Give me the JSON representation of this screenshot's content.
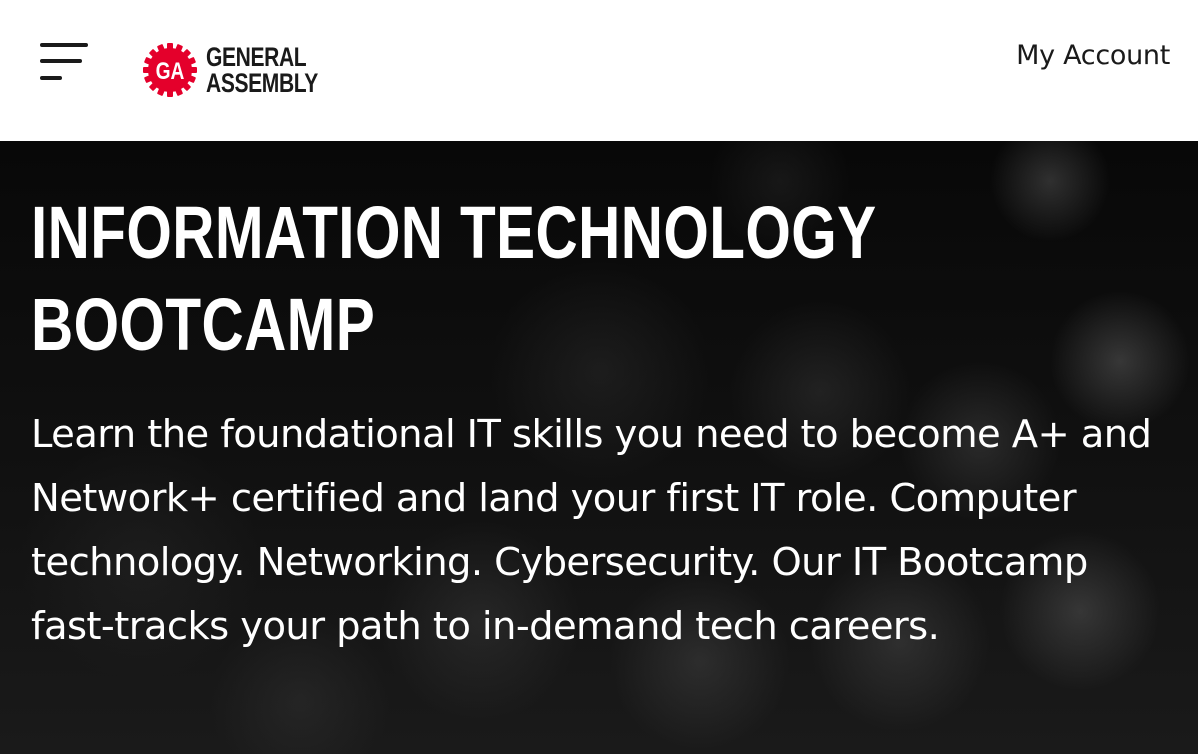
{
  "header": {
    "logo_line1": "GENERAL",
    "logo_line2": "ASSEMBLY",
    "logo_mark": "GA",
    "account_link": "My Account",
    "brand_color": "#e4002b"
  },
  "hero": {
    "title_line1": "INFORMATION TECHNOLOGY",
    "title_line2": "BOOTCAMP",
    "description": "Learn the foundational IT skills you need to become A+ and Network+ certified and land your first IT role. Computer technology. Networking. Cybersecurity. Our IT Bootcamp fast-tracks your path to in-demand tech careers."
  },
  "icons": {
    "menu": "hamburger-menu-icon",
    "logo": "general-assembly-gear-logo"
  }
}
